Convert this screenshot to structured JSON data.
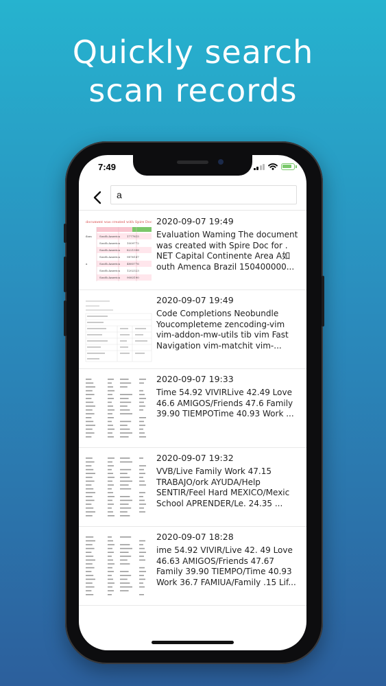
{
  "headline": {
    "line1": "Quickly search",
    "line2": "scan records"
  },
  "status_bar": {
    "time": "7:49"
  },
  "search": {
    "value": "a"
  },
  "records": [
    {
      "date": "2020-09-07 19:49",
      "text": "Evaluation Waming The document was created with Spire Doc for . NET Capital   Continente    Area   A如 outh Amenca   Brazil   150400000...",
      "thumb": "table-pink"
    },
    {
      "date": "2020-09-07 19:49",
      "text": "Code Completions   Neobundle Youcompleteme zencoding-vim vim-addon-mw-utils   tib vim   Fast Navigation   vim-matchit vim-...",
      "thumb": "doc-grid"
    },
    {
      "date": "2020-09-07 19:33",
      "text": "Time   54.92   VIVIRLive   42.49 Love   46.6   AMIGOS/Friends 47.6      Family   39.90 TIEMPOTime   40.93      Work   ...",
      "thumb": "text-columns"
    },
    {
      "date": "2020-09-07 19:32",
      "text": " VVB/Live   Family   Work   47.15 TRABAJO/ork   AYUDA/Help SENTIR/Feel   Hard   MEXICO/Mexic School   APRENDER/Le.   24.35   ...",
      "thumb": "text-columns"
    },
    {
      "date": "2020-09-07 18:28",
      "text": "ime 54.92 VIVIR/Live 42. 49    Love 46.63 AMIGOS/Friends 47.67 Family 39.90 TIEMPO/Time 40.93 Work 36.7 FAMIUA/Family .15    Lif...",
      "thumb": "text-columns"
    }
  ]
}
